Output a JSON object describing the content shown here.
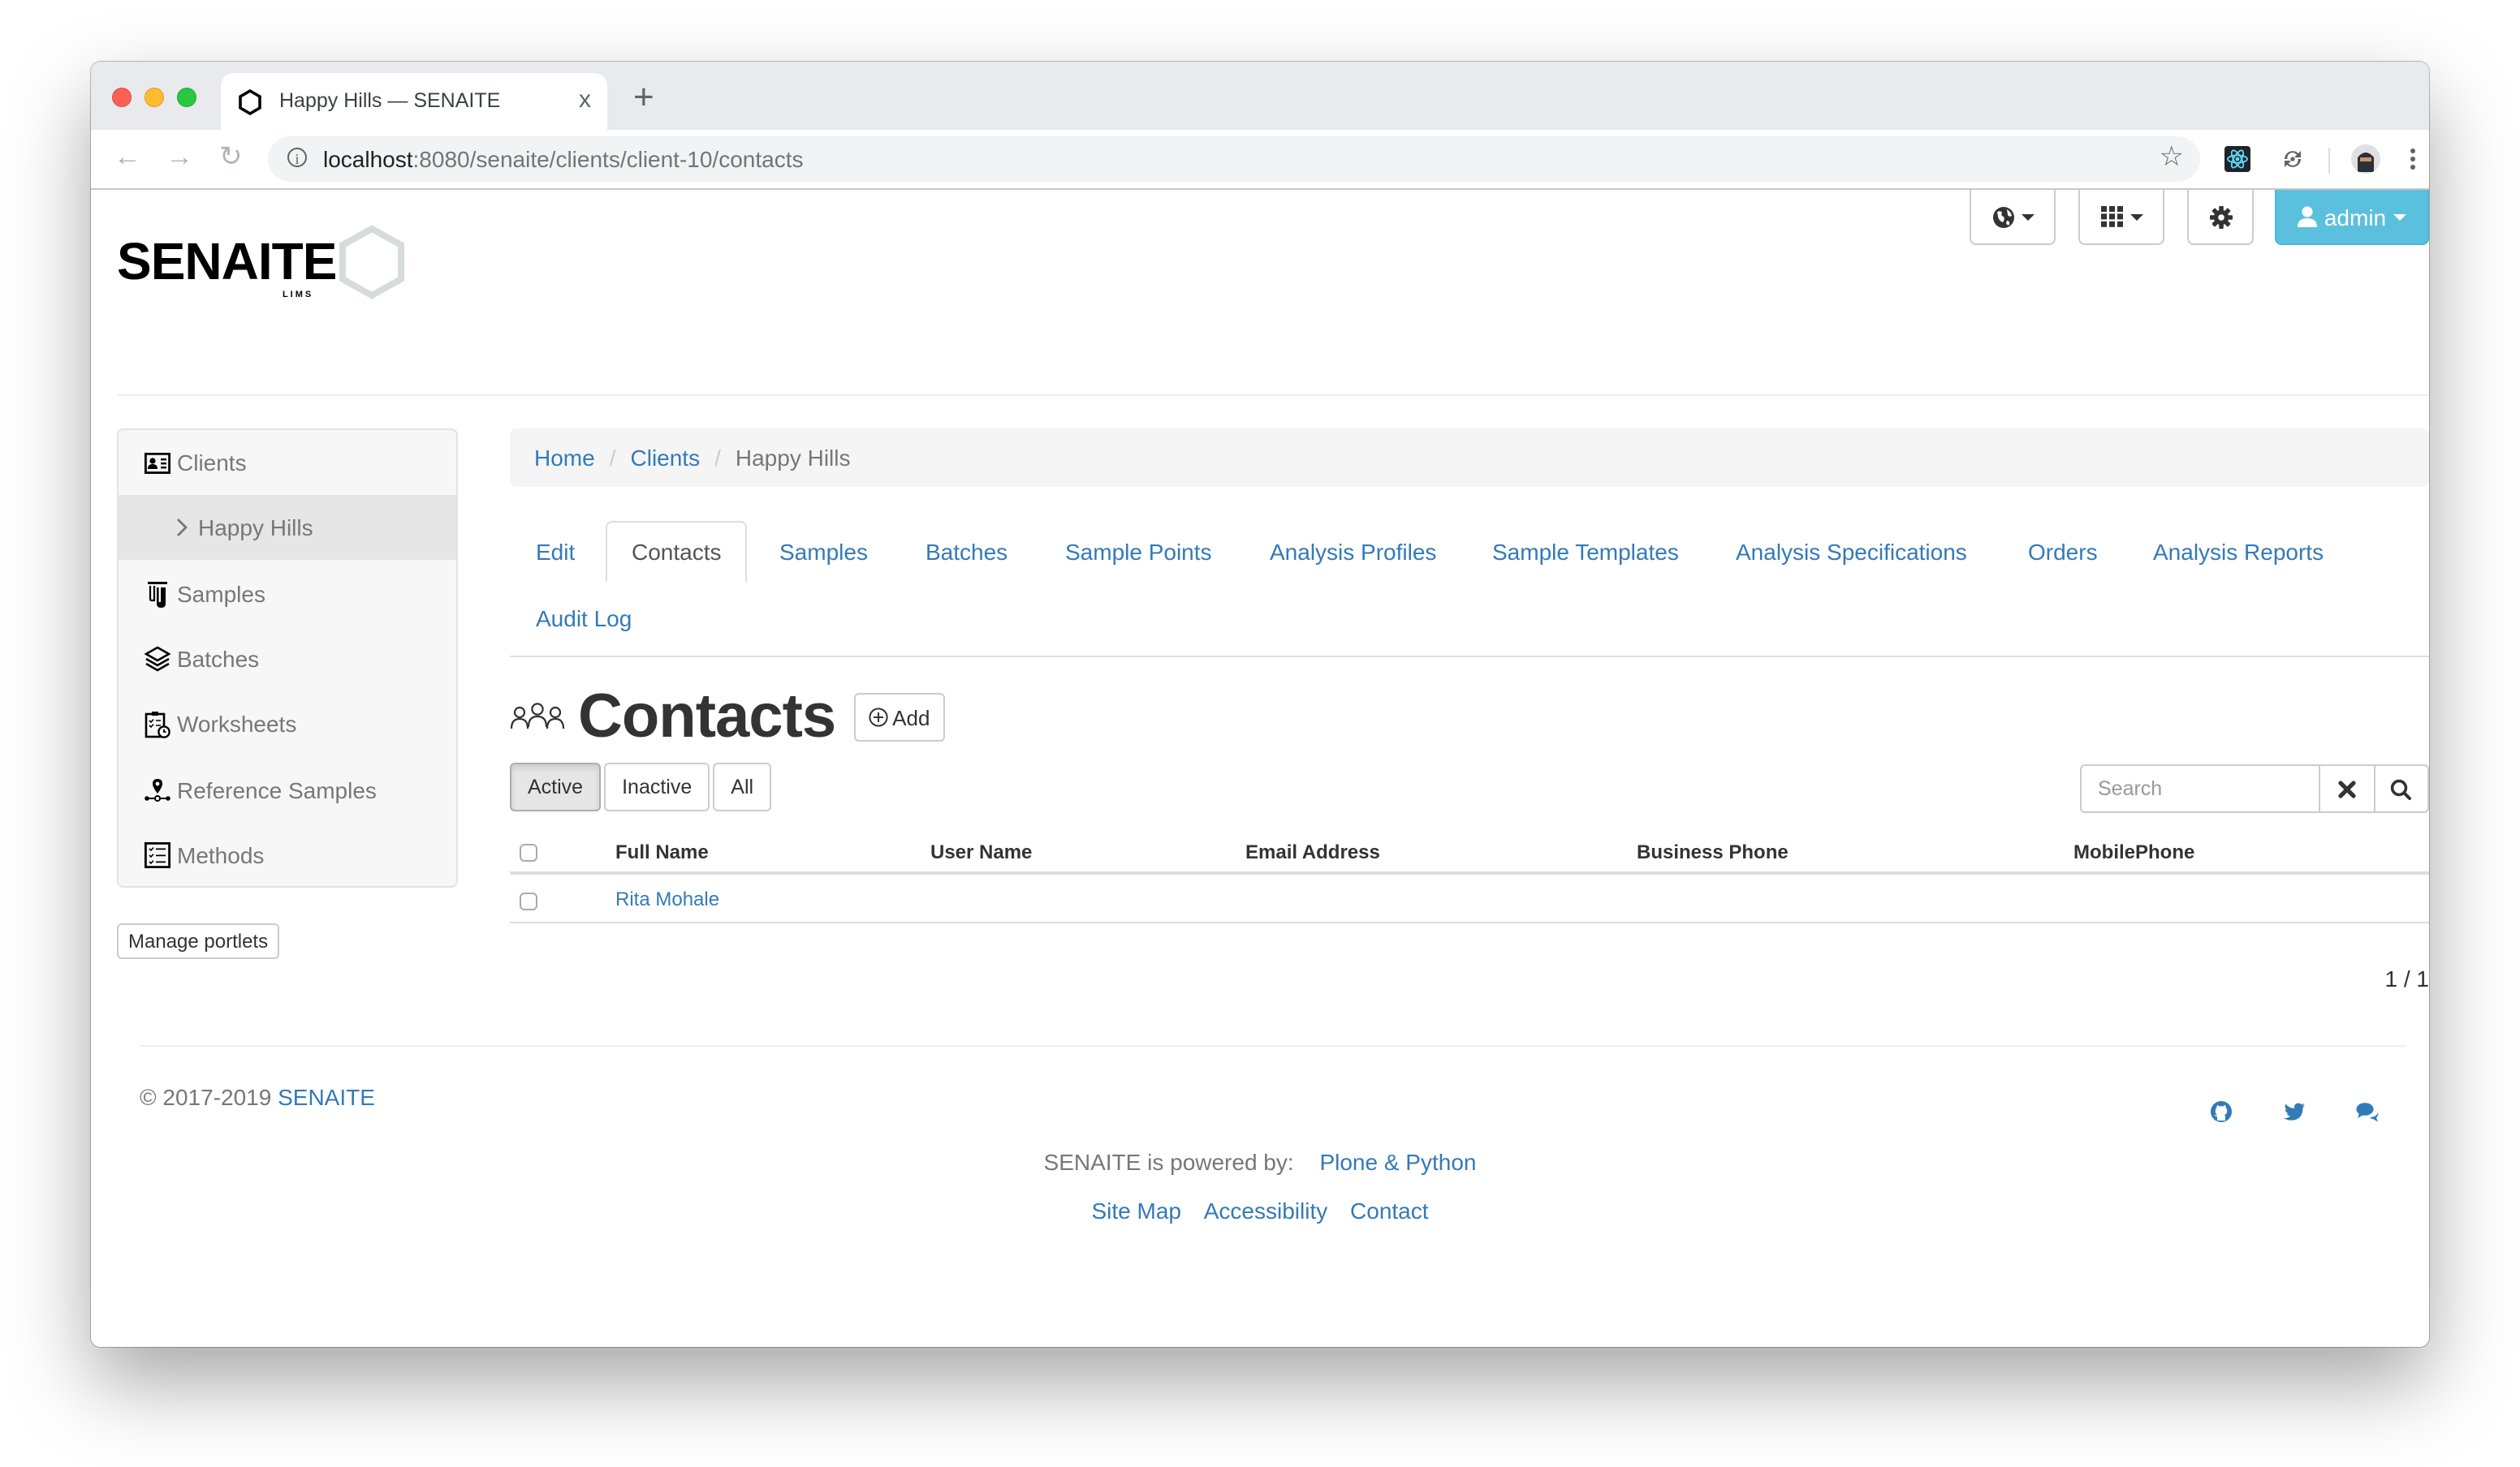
{
  "browser": {
    "tab_title": "Happy Hills — SENAITE",
    "tab_close": "x",
    "new_tab": "+",
    "url_host": "localhost",
    "url_rest": ":8080/senaite/clients/client-10/contacts",
    "traffic_lights": {
      "close": "#fe5f57",
      "minimize": "#febc2e",
      "zoom": "#28c840"
    }
  },
  "header": {
    "logo_text": "SENAITE",
    "logo_sub": "L I M S",
    "user_label": "admin",
    "accent_color": "#5bc0de"
  },
  "sidebar": {
    "items": [
      {
        "label": "Clients",
        "icon": "id-card-icon"
      },
      {
        "label": "Happy Hills",
        "icon": "chevron-right-icon",
        "active": true
      },
      {
        "label": "Samples",
        "icon": "test-tube-icon"
      },
      {
        "label": "Batches",
        "icon": "layers-icon"
      },
      {
        "label": "Worksheets",
        "icon": "clipboard-clock-icon"
      },
      {
        "label": "Reference Samples",
        "icon": "location-pin-icon"
      },
      {
        "label": "Methods",
        "icon": "checklist-icon"
      }
    ],
    "manage_portlets": "Manage portlets"
  },
  "breadcrumb": {
    "items": [
      "Home",
      "Clients"
    ],
    "current": "Happy Hills",
    "separator": "/"
  },
  "content_tabs": [
    {
      "label": "Edit"
    },
    {
      "label": "Contacts",
      "active": true
    },
    {
      "label": "Samples"
    },
    {
      "label": "Batches"
    },
    {
      "label": "Sample Points"
    },
    {
      "label": "Analysis Profiles"
    },
    {
      "label": "Sample Templates"
    },
    {
      "label": "Analysis Specifications"
    },
    {
      "label": "Orders"
    },
    {
      "label": "Analysis Reports"
    },
    {
      "label": "Audit Log"
    }
  ],
  "main": {
    "title": "Contacts",
    "add_label": "Add",
    "filters": [
      {
        "label": "Active",
        "active": true
      },
      {
        "label": "Inactive"
      },
      {
        "label": "All"
      }
    ],
    "search_placeholder": "Search",
    "table": {
      "columns": [
        "Full Name",
        "User Name",
        "Email Address",
        "Business Phone",
        "MobilePhone"
      ],
      "rows": [
        {
          "full_name": "Rita Mohale",
          "user_name": "",
          "email": "",
          "business_phone": "",
          "mobile_phone": ""
        }
      ]
    },
    "pager": "1 / 1"
  },
  "footer": {
    "copyright": "© 2017-2019",
    "copyright_link": "SENAITE",
    "powered_text": "SENAITE is powered by:",
    "powered_link": "Plone & Python",
    "links": [
      "Site Map",
      "Accessibility",
      "Contact"
    ],
    "social": [
      "github-icon",
      "twitter-icon",
      "chat-icon"
    ],
    "link_color": "#337ab7"
  }
}
